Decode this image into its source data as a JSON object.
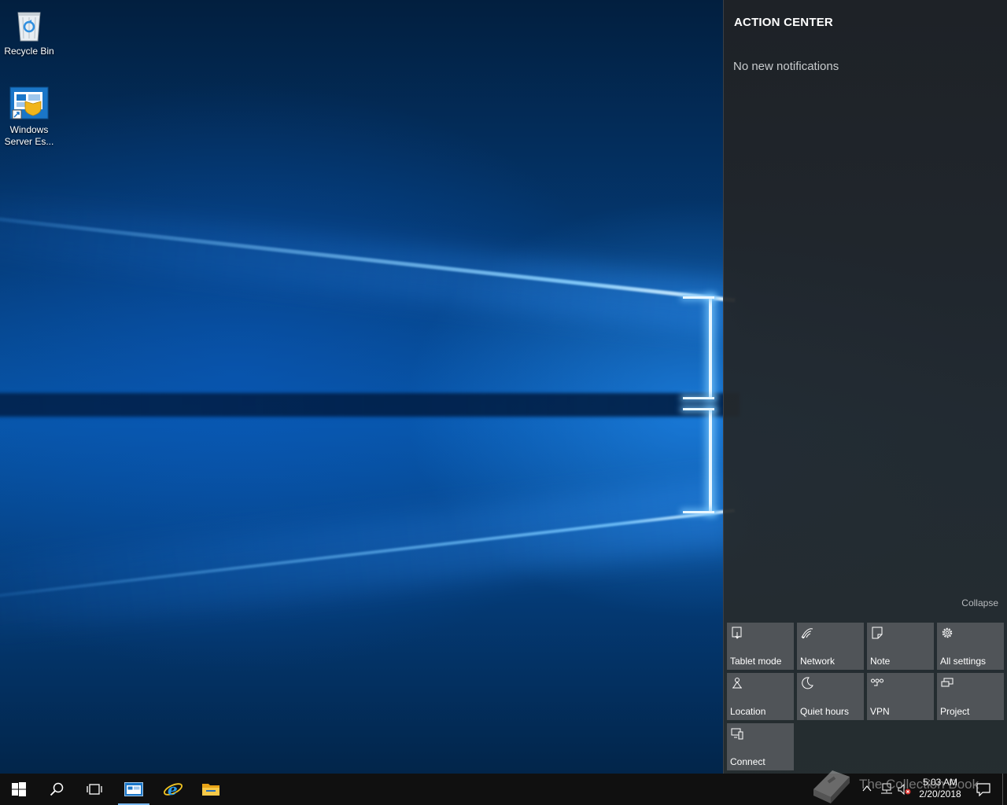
{
  "desktop": {
    "icons": [
      {
        "label": "Recycle Bin",
        "icon": "recycle-bin-icon"
      },
      {
        "label": "Windows Server Es...",
        "icon": "windows-server-essentials-icon"
      }
    ]
  },
  "action_center": {
    "title": "ACTION CENTER",
    "empty_message": "No new notifications",
    "collapse_label": "Collapse",
    "quick_actions": [
      {
        "label": "Tablet mode",
        "icon": "tablet-mode-icon"
      },
      {
        "label": "Network",
        "icon": "network-icon"
      },
      {
        "label": "Note",
        "icon": "note-icon"
      },
      {
        "label": "All settings",
        "icon": "gear-icon"
      },
      {
        "label": "Location",
        "icon": "location-icon"
      },
      {
        "label": "Quiet hours",
        "icon": "moon-icon"
      },
      {
        "label": "VPN",
        "icon": "vpn-icon"
      },
      {
        "label": "Project",
        "icon": "project-icon"
      },
      {
        "label": "Connect",
        "icon": "connect-icon"
      }
    ]
  },
  "taskbar": {
    "pinned": [
      "start-icon",
      "search-icon",
      "task-view-icon",
      "server-dashboard-icon",
      "internet-explorer-icon",
      "file-explorer-icon"
    ],
    "clock": {
      "time": "5:03 AM",
      "date": "2/20/2018"
    },
    "watermark": "The Collection Book",
    "colors": {
      "background": "#101010",
      "accent": "#0078d7"
    }
  }
}
